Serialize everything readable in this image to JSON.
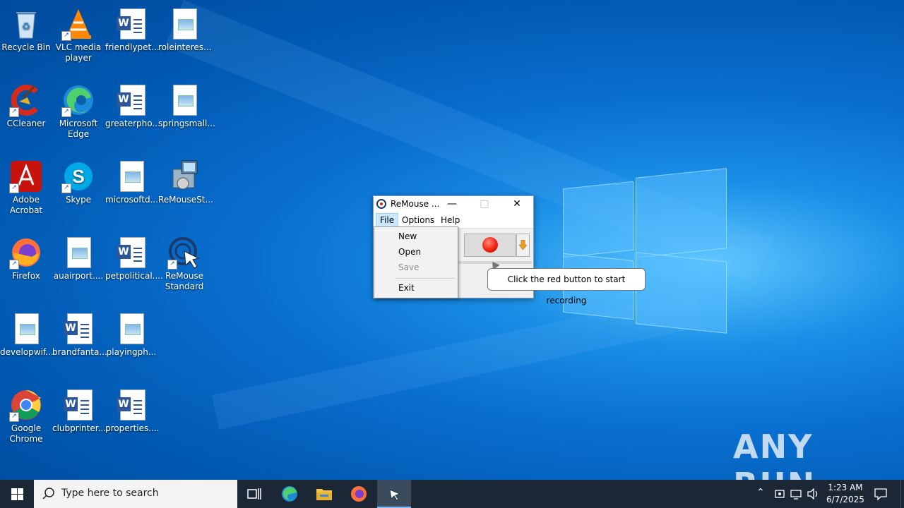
{
  "desktop": {
    "icons": [
      {
        "label": "Recycle Bin",
        "icon": "recycle-bin-icon"
      },
      {
        "label": "VLC media player",
        "icon": "vlc-icon"
      },
      {
        "label": "friendlypet...",
        "icon": "word-document-icon"
      },
      {
        "label": "roleinteres...",
        "icon": "image-document-icon"
      },
      {
        "label": "CCleaner",
        "icon": "ccleaner-icon"
      },
      {
        "label": "Microsoft Edge",
        "icon": "edge-icon"
      },
      {
        "label": "greaterpho...",
        "icon": "word-document-icon"
      },
      {
        "label": "springsmall...",
        "icon": "image-document-icon"
      },
      {
        "label": "Adobe Acrobat",
        "icon": "acrobat-icon"
      },
      {
        "label": "Skype",
        "icon": "skype-icon"
      },
      {
        "label": "microsoftd...",
        "icon": "image-document-icon"
      },
      {
        "label": "ReMouseSt...",
        "icon": "installer-icon"
      },
      {
        "label": "Firefox",
        "icon": "firefox-icon"
      },
      {
        "label": "auairport....",
        "icon": "image-document-icon"
      },
      {
        "label": "petpolitical....",
        "icon": "word-document-icon"
      },
      {
        "label": "ReMouse Standard",
        "icon": "remouse-icon"
      },
      {
        "label": "developwif...",
        "icon": "image-document-icon"
      },
      {
        "label": "brandfanta...",
        "icon": "word-document-icon"
      },
      {
        "label": "playingph...",
        "icon": "image-document-icon"
      },
      {
        "label": "Google Chrome",
        "icon": "chrome-icon"
      },
      {
        "label": "clubprinter....",
        "icon": "word-document-icon"
      },
      {
        "label": "properties....",
        "icon": "word-document-icon"
      }
    ]
  },
  "remouse": {
    "title": "ReMouse ...",
    "menu": {
      "file": "File",
      "options": "Options",
      "help": "Help"
    },
    "file_menu": {
      "new": "New",
      "open": "Open",
      "save": "Save",
      "exit": "Exit"
    },
    "tooltip": "Click the red button to start recording"
  },
  "watermark": "ANY RUN",
  "taskbar": {
    "search_placeholder": "Type here to search",
    "time": "1:23 AM",
    "date": "6/7/2025"
  },
  "colors": {
    "taskbar": "#1b2734",
    "record_red": "#f0220f",
    "desktop_blue": "#0a6fd0"
  }
}
